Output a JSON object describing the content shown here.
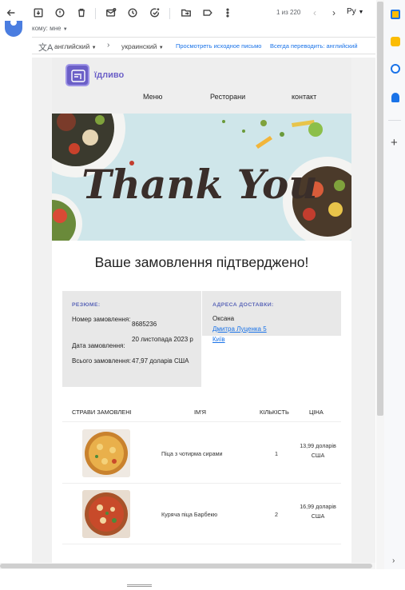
{
  "toolbar": {
    "icons": [
      "back-icon",
      "archive-icon",
      "report-icon",
      "delete-icon",
      "mark-unread-icon",
      "snooze-icon",
      "add-task-icon",
      "move-icon",
      "label-icon",
      "more-icon"
    ],
    "pager_text": "1 из 220",
    "language_label": "Ру"
  },
  "sender": {
    "to_text": "кому: мне"
  },
  "translate": {
    "from_lang": "английский",
    "to_lang": "украинский",
    "view_original": "Просмотреть исходное письмо",
    "always_translate": "Всегда переводить: английский"
  },
  "email": {
    "brand": "їдливо",
    "nav": [
      "Меню",
      "Ресторани",
      "контакт"
    ],
    "hero_text": "Thank You",
    "title": "Ваше замовлення підтверджено!",
    "summary": {
      "heading": "РЕЗЮМЕ:",
      "order_number_label": "Номер замовлення:",
      "order_number_value": "8685236",
      "order_date_label": "Дата замовлення:",
      "order_date_value": "20 листопада 2023 р",
      "total_label": "Всього замовлення:",
      "total_value": "47,97 доларів США"
    },
    "delivery": {
      "heading": "АДРЕСА ДОСТАВКИ:",
      "name": "Оксана",
      "street": "Дмитра Луценка 5",
      "city": "Київ"
    },
    "table": {
      "headers": [
        "СТРАВИ ЗАМОВЛЕНІ",
        "ІМ'Я",
        "КІЛЬКІСТЬ",
        "ЦІНА"
      ],
      "rows": [
        {
          "name": "Піца з чотирма сирами",
          "qty": "1",
          "price": "13,99 доларів США"
        },
        {
          "name": "Куряча піца Барбекю",
          "qty": "2",
          "price": "16,99 доларів США"
        }
      ]
    }
  },
  "colors": {
    "accent": "#6b5fc7",
    "link": "#1a73e8",
    "section_heading": "#5b66b8"
  }
}
